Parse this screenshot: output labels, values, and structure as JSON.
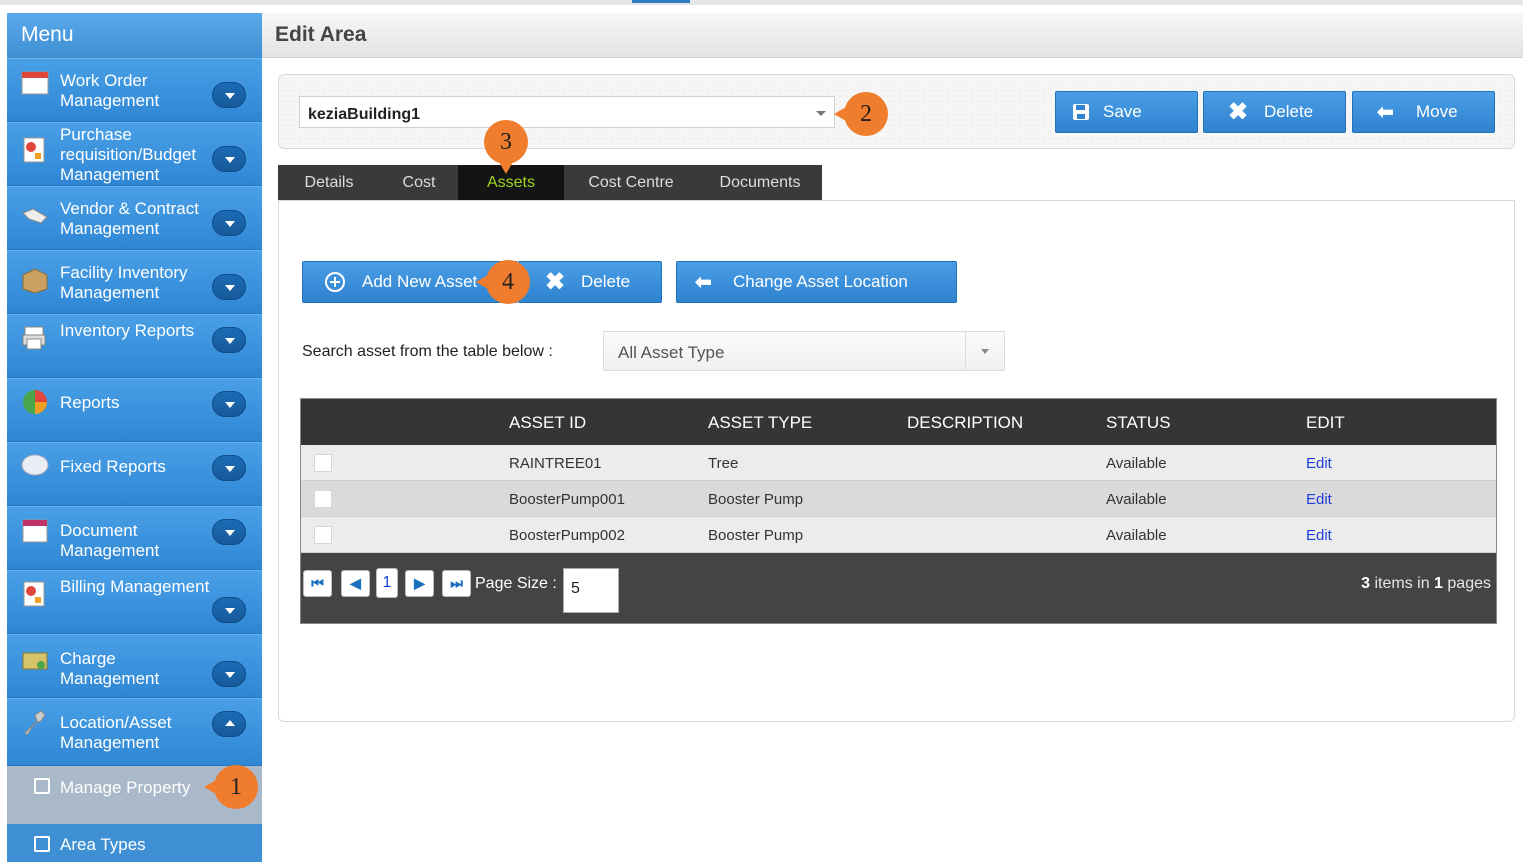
{
  "sidebar": {
    "title": "Menu",
    "items": [
      {
        "label": "Work Order Management"
      },
      {
        "label": "Purchase requisition/Budget Management"
      },
      {
        "label": "Vendor & Contract Management"
      },
      {
        "label": "Facility Inventory Management"
      },
      {
        "label": "Inventory Reports"
      },
      {
        "label": "Reports"
      },
      {
        "label": "Fixed Reports"
      },
      {
        "label": "Document Management"
      },
      {
        "label": "Billing Management"
      },
      {
        "label": "Charge Management"
      },
      {
        "label": "Location/Asset Management"
      }
    ],
    "subitems": [
      {
        "label": "Manage Property"
      },
      {
        "label": "Area Types"
      }
    ]
  },
  "header": {
    "title": "Edit Area"
  },
  "area": {
    "selected": "keziaBuilding1"
  },
  "toolbar": {
    "save": "Save",
    "delete": "Delete",
    "move": "Move"
  },
  "tabs": [
    {
      "label": "Details"
    },
    {
      "label": "Cost"
    },
    {
      "label": "Assets"
    },
    {
      "label": "Cost Centre"
    },
    {
      "label": "Documents"
    }
  ],
  "assets_toolbar": {
    "add": "Add New Asset",
    "delete": "Delete",
    "change_location": "Change Asset Location"
  },
  "search": {
    "label": "Search asset from the table below :",
    "asset_type": "All Asset Type"
  },
  "table": {
    "columns": [
      "ASSET ID",
      "ASSET TYPE",
      "DESCRIPTION",
      "STATUS",
      "EDIT"
    ],
    "rows": [
      {
        "asset_id": "RAINTREE01",
        "asset_type": "Tree",
        "description": "",
        "status": "Available",
        "edit": "Edit"
      },
      {
        "asset_id": "BoosterPump001",
        "asset_type": "Booster Pump",
        "description": "",
        "status": "Available",
        "edit": "Edit"
      },
      {
        "asset_id": "BoosterPump002",
        "asset_type": "Booster Pump",
        "description": "",
        "status": "Available",
        "edit": "Edit"
      }
    ]
  },
  "pager": {
    "current_page": "1",
    "page_size_label": "Page Size :",
    "page_size": "5",
    "items_count": "3",
    "items_mid": " items in ",
    "pages_count": "1",
    "pages_suffix": " pages"
  },
  "callouts": [
    "1",
    "2",
    "3",
    "4"
  ],
  "colors": {
    "accent": "#3d8fd6",
    "active_tab_text": "#9fd320",
    "callout": "#ef7d2d"
  }
}
